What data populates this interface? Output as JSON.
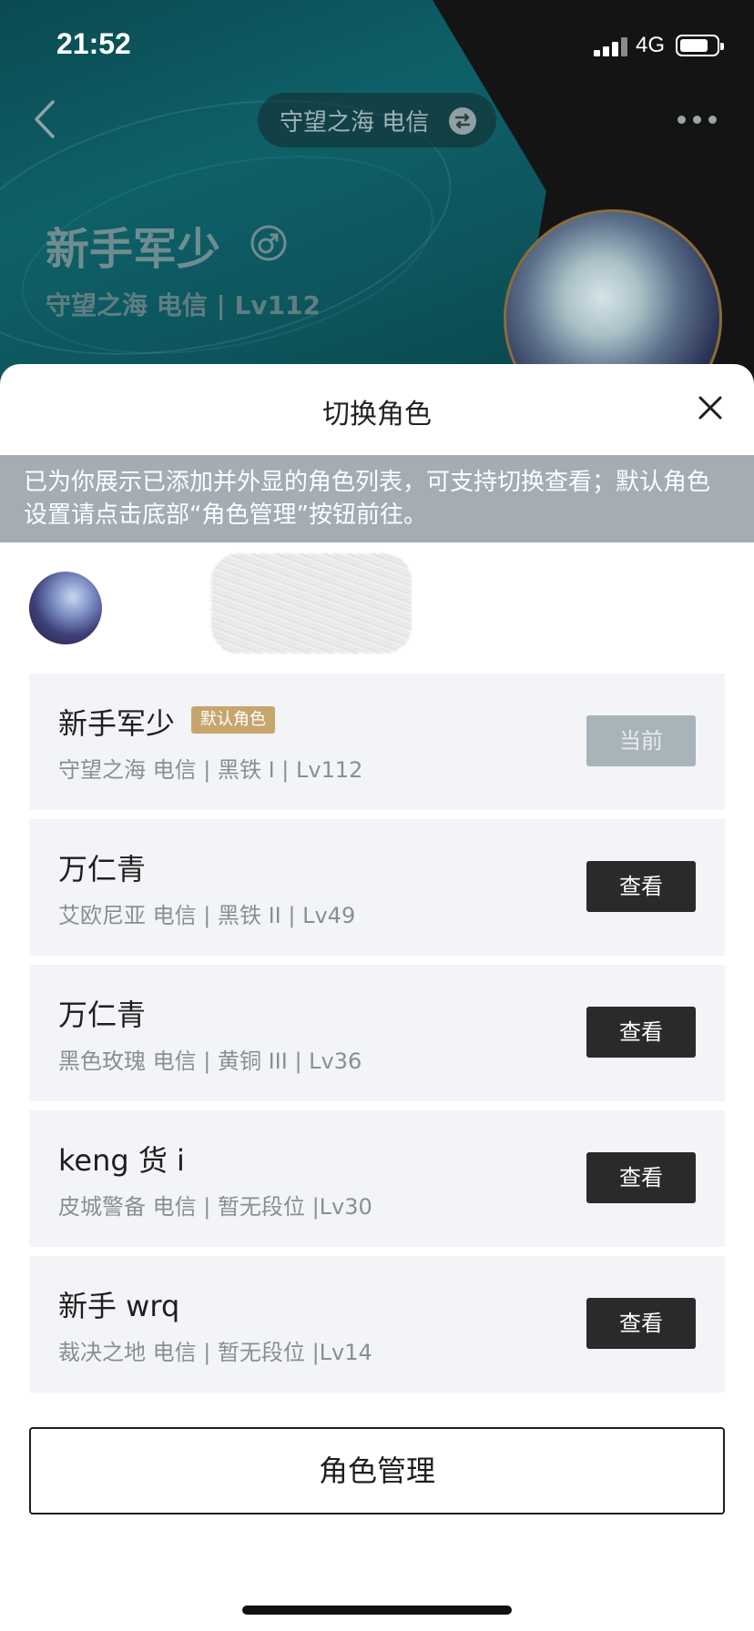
{
  "status_bar": {
    "time": "21:52",
    "network": "4G"
  },
  "header": {
    "server_label": "守望之海 电信",
    "player_name": "新手军少",
    "player_sub": "守望之海 电信 | Lv112"
  },
  "sheet": {
    "title": "切换角色",
    "notice": "已为你展示已添加并外显的角色列表，可支持切换查看；默认角色设置请点击底部“角色管理”按钮前往。",
    "roles": [
      {
        "name": "新手军少",
        "tag": "默认角色",
        "sub": "守望之海 电信 | 黑铁 I | Lv112",
        "button": "当前",
        "current": true
      },
      {
        "name": "万仁青",
        "tag": "",
        "sub": "艾欧尼亚 电信 | 黑铁 II | Lv49",
        "button": "查看",
        "current": false
      },
      {
        "name": "万仁青",
        "tag": "",
        "sub": "黑色玫瑰 电信 | 黄铜 III | Lv36",
        "button": "查看",
        "current": false
      },
      {
        "name": "keng 货 i",
        "tag": "",
        "sub": "皮城警备 电信 | 暂无段位 |Lv30",
        "button": "查看",
        "current": false
      },
      {
        "name": "新手 wrq",
        "tag": "",
        "sub": "裁决之地 电信 | 暂无段位 |Lv14",
        "button": "查看",
        "current": false
      }
    ],
    "manage_button": "角色管理"
  },
  "icons": {
    "back": "chevron-left-icon",
    "swap": "swap-icon",
    "more": "more-icon",
    "gender": "male-icon",
    "close": "close-icon"
  },
  "colors": {
    "default_tag": "#c6a66d",
    "view_button": "#2a2a2a",
    "current_button": "#a9b3ba",
    "notice_bg": "#a3adb3",
    "card_bg": "#f2f4f7"
  }
}
